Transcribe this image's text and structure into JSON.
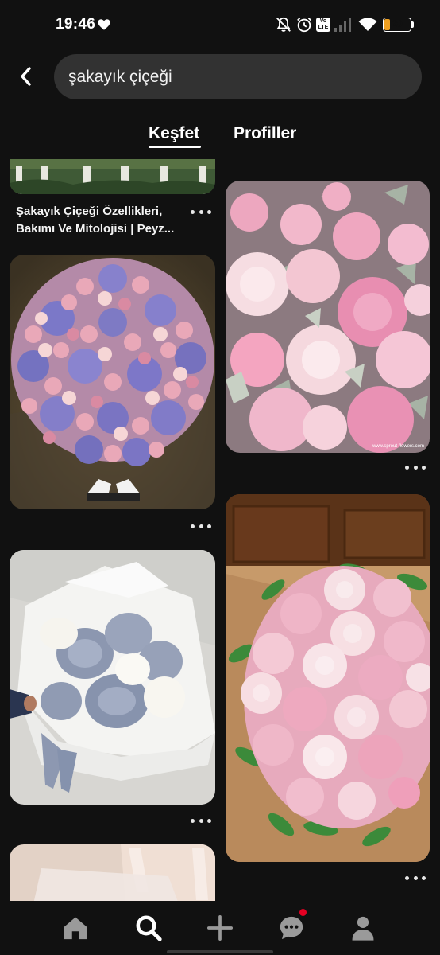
{
  "status_bar": {
    "time": "19:46",
    "battery": "20",
    "battery_level": 0.2,
    "volte_label": "Vo LTE",
    "icons": [
      "heart-icon",
      "mute-icon",
      "alarm-icon",
      "volte-icon",
      "signal-icon",
      "wifi-icon",
      "battery-icon"
    ]
  },
  "search": {
    "query": "şakayık çiçeği",
    "back_icon": "chevron-left-icon"
  },
  "tabs": [
    {
      "label": "Keşfet",
      "active": true
    },
    {
      "label": "Profiller",
      "active": false
    }
  ],
  "feed": {
    "pins": [
      {
        "title_line1": "Şakayık Çiçeği Özellikleri,",
        "title_line2": "Bakımı Ve Mitolojisi | Peyz...",
        "image": "garden fence with plants"
      },
      {
        "image": "pink and white peonies bunch",
        "watermark": "www.sprout-flowers.com"
      },
      {
        "image": "round bouquet of pink peonies and purple hydrangeas"
      },
      {
        "image": "large bouquet of pink and white peonies on wooden floor"
      },
      {
        "image": "bouquet of blue-grey and white peonies in white wrapping"
      },
      {
        "image": "bouquet partially visible"
      }
    ],
    "more_icon": "more-horizontal-icon"
  },
  "bottom_nav": {
    "items": [
      "home-icon",
      "search-icon",
      "plus-icon",
      "messages-icon",
      "profile-icon"
    ],
    "active": "search-icon",
    "notification_color": "#e60023"
  },
  "colors": {
    "background": "#111111",
    "search_field": "#323232",
    "text": "#ffffff"
  }
}
